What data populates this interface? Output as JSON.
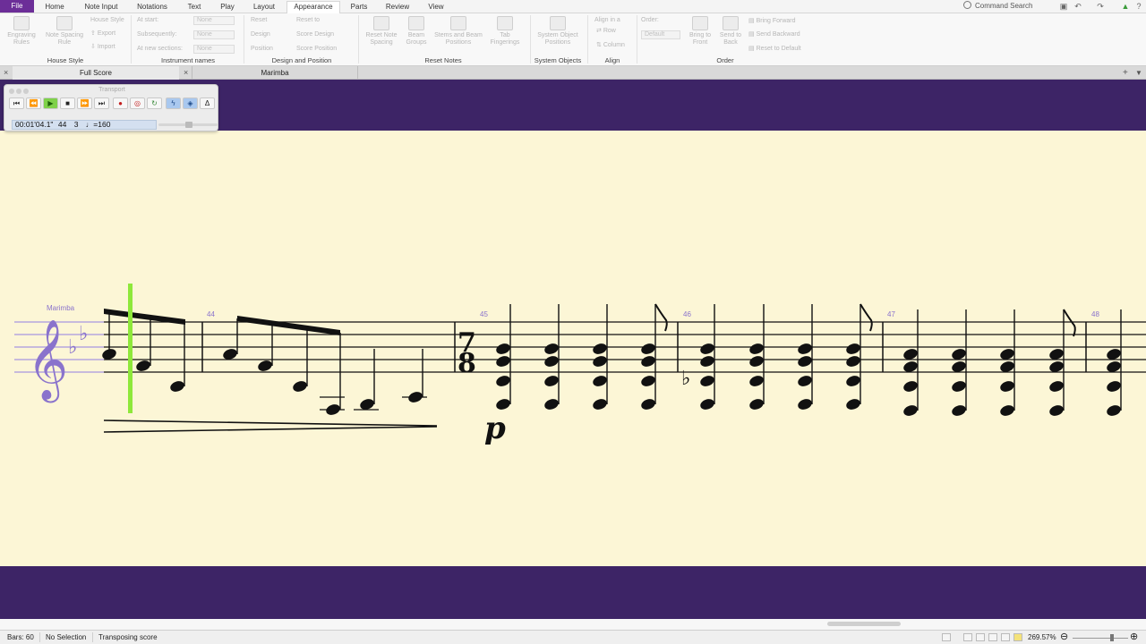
{
  "tabs": [
    "File",
    "Home",
    "Note Input",
    "Notations",
    "Text",
    "Play",
    "Layout",
    "Appearance",
    "Parts",
    "Review",
    "View"
  ],
  "active_tab": "Appearance",
  "command_search": "Command Search",
  "ribbon": {
    "house_style": {
      "engraving_rules": "Engraving Rules",
      "note_spacing_rule": "Note Spacing Rule",
      "house_style_btn": "House Style",
      "export": "Export",
      "import": "Import",
      "group": "House Style"
    },
    "instrument_names": {
      "at_start": "At start:",
      "subsequently": "Subsequently:",
      "at_new_sections": "At new sections:",
      "none1": "None",
      "none2": "None",
      "none3": "None",
      "group": "Instrument names"
    },
    "design_position": {
      "reset": "Reset",
      "reset_to": "Reset to",
      "design": "Design",
      "score_design": "Score Design",
      "position": "Position",
      "score_position": "Score Position",
      "group": "Design and Position"
    },
    "reset_notes": {
      "reset_note_spacing": "Reset Note Spacing",
      "beam_groups": "Beam Groups",
      "stems_beam": "Stems and Beam Positions",
      "tab_fingerings": "Tab Fingerings",
      "group": "Reset Notes"
    },
    "system_objects": {
      "positions": "System Object Positions",
      "group": "System Objects"
    },
    "align": {
      "align_in_a": "Align in a",
      "row": "Row",
      "column": "Column",
      "group": "Align"
    },
    "order": {
      "order_label": "Order:",
      "default": "Default",
      "bring_to_front": "Bring to Front",
      "send_to_back": "Send to Back",
      "bring_forward": "Bring Forward",
      "send_backward": "Send Backward",
      "reset_to_default": "Reset to Default",
      "group": "Order"
    }
  },
  "doc_tabs": [
    "Full Score",
    "Marimba"
  ],
  "transport": {
    "title": "Transport",
    "time": "00:01'04.1\"",
    "bar": "44",
    "beat": "3",
    "tempo": "♩=160"
  },
  "score": {
    "instrument": "Marimba",
    "bar_numbers": [
      "44",
      "45",
      "46",
      "47",
      "48"
    ],
    "time_signature": {
      "top": "7",
      "bottom": "8"
    },
    "dynamic": "p"
  },
  "status": {
    "bars": "Bars: 60",
    "selection": "No Selection",
    "mode": "Transposing score",
    "zoom": "269.57%"
  },
  "colors": {
    "file_tab": "#6c2e98",
    "score_background": "#3d2466",
    "paper": "#fcf6d6",
    "playback_line": "#8ee83a",
    "bar_numbers": "#8a73cc"
  }
}
